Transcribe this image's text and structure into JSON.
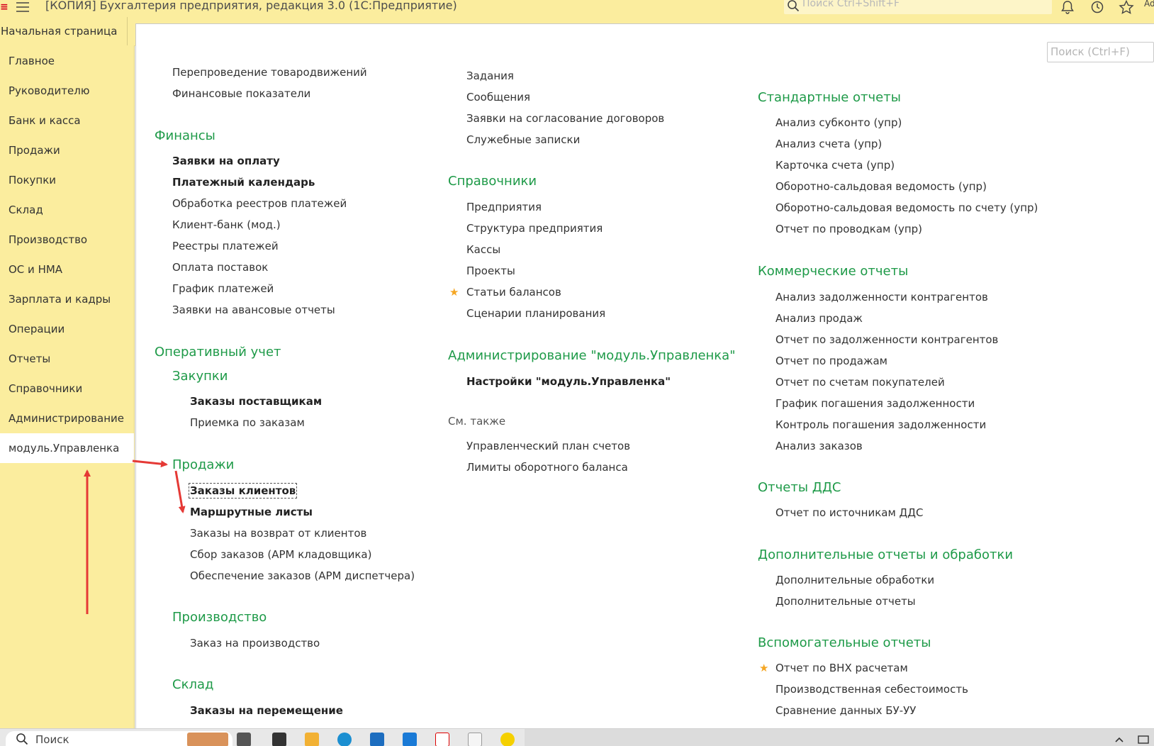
{
  "titlebar": {
    "title": "[КОПИЯ] Бухгалтерия предприятия, редакция 3.0  (1С:Предприятие)",
    "search_placeholder": "Поиск Ctrl+Shift+F",
    "more_label": "Ad"
  },
  "tabs": {
    "home": "Начальная страница"
  },
  "sidebar": {
    "items": [
      {
        "label": "Главное"
      },
      {
        "label": "Руководителю"
      },
      {
        "label": "Банк и касса"
      },
      {
        "label": "Продажи"
      },
      {
        "label": "Покупки"
      },
      {
        "label": "Склад"
      },
      {
        "label": "Производство"
      },
      {
        "label": "ОС и НМА"
      },
      {
        "label": "Зарплата и кадры"
      },
      {
        "label": "Операции"
      },
      {
        "label": "Отчеты"
      },
      {
        "label": "Справочники"
      },
      {
        "label": "Администрирование"
      },
      {
        "label": "модуль.Управленка"
      }
    ]
  },
  "page_search": {
    "placeholder": "Поиск (Ctrl+F)"
  },
  "col1": {
    "top_items": [
      "Перепроведение товародвижений",
      "Финансовые показатели"
    ],
    "finance": {
      "title": "Финансы",
      "items": [
        "Заявки на оплату",
        "Платежный календарь",
        "Обработка реестров платежей",
        "Клиент-банк (мод.)",
        "Реестры платежей",
        "Оплата поставок",
        "График платежей",
        "Заявки на авансовые отчеты"
      ]
    },
    "operative": {
      "title": "Оперативный учет",
      "purchases": {
        "title": "Закупки",
        "items": [
          "Заказы поставщикам",
          "Приемка по заказам"
        ]
      },
      "sales": {
        "title": "Продажи",
        "items": [
          "Заказы клиентов",
          "Маршрутные листы",
          "Заказы на возврат от клиентов",
          "Сбор заказов (АРМ кладовщика)",
          "Обеспечение заказов (АРМ диспетчера)"
        ]
      },
      "production": {
        "title": "Производство",
        "items": [
          "Заказ на производство"
        ]
      },
      "warehouse": {
        "title": "Склад",
        "items": [
          "Заказы на перемещение"
        ]
      }
    }
  },
  "col2": {
    "top_items": [
      "Задания",
      "Сообщения",
      "Заявки на согласование договоров",
      "Служебные записки"
    ],
    "references": {
      "title": "Справочники",
      "items": [
        "Предприятия",
        "Структура предприятия",
        "Кассы",
        "Проекты",
        "Статьи балансов",
        "Сценарии планирования"
      ]
    },
    "admin": {
      "title": "Администрирование \"модуль.Управленка\"",
      "items": [
        "Настройки \"модуль.Управленка\""
      ]
    },
    "see_also": {
      "title": "См. также",
      "items": [
        "Управленческий план счетов",
        "Лимиты оборотного баланса"
      ]
    }
  },
  "col3": {
    "standard": {
      "title": "Стандартные отчеты",
      "items": [
        "Анализ субконто (упр)",
        "Анализ счета (упр)",
        "Карточка счета (упр)",
        "Оборотно-сальдовая ведомость (упр)",
        "Оборотно-сальдовая ведомость по счету (упр)",
        "Отчет по проводкам (упр)"
      ]
    },
    "commercial": {
      "title": "Коммерческие отчеты",
      "items": [
        "Анализ задолженности контрагентов",
        "Анализ продаж",
        "Отчет по задолженности контрагентов",
        "Отчет по продажам",
        "Отчет по счетам покупателей",
        "График погашения задолженности",
        "Контроль погашения задолженности",
        "Анализ заказов"
      ]
    },
    "dds": {
      "title": "Отчеты ДДС",
      "items": [
        "Отчет по источникам ДДС"
      ]
    },
    "additional": {
      "title": "Дополнительные отчеты и обработки",
      "items": [
        "Дополнительные обработки",
        "Дополнительные отчеты"
      ]
    },
    "auxiliary": {
      "title": "Вспомогательные отчеты",
      "items": [
        "Отчет по ВНХ расчетам",
        "Производственная себестоимость",
        "Сравнение данных БУ-УУ"
      ]
    }
  },
  "taskbar": {
    "search_placeholder": "Поиск"
  },
  "colors": {
    "accent_green": "#1e9a48",
    "sidebar_bg": "#fbed9e",
    "arrow_red": "#e53935",
    "star": "#f5a623"
  },
  "icons": [
    "menu-icon",
    "search-icon",
    "bell-icon",
    "history-icon",
    "star-icon"
  ]
}
